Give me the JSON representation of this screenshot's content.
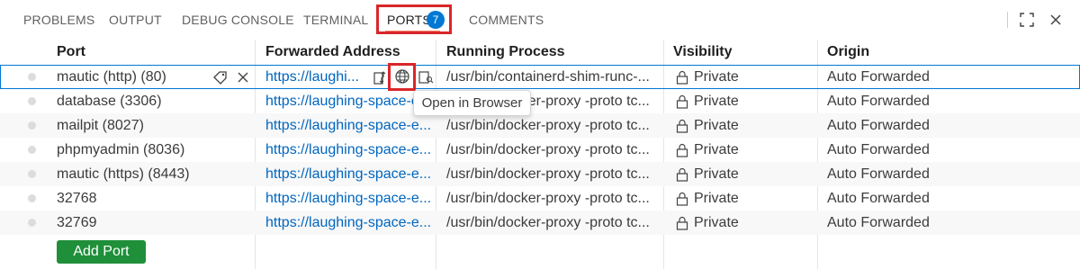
{
  "panel": {
    "tabs": [
      {
        "label": "PROBLEMS"
      },
      {
        "label": "OUTPUT"
      },
      {
        "label": "DEBUG CONSOLE"
      },
      {
        "label": "TERMINAL"
      },
      {
        "label": "PORTS",
        "badge": "7",
        "active": true
      },
      {
        "label": "COMMENTS"
      }
    ],
    "actions": [
      {
        "icon": "maximize-icon"
      },
      {
        "icon": "close-icon"
      }
    ]
  },
  "table": {
    "headers": [
      "Port",
      "Forwarded Address",
      "Running Process",
      "Visibility",
      "Origin"
    ],
    "rows": [
      {
        "port": "mautic (http) (80)",
        "address": "https://laughi...",
        "process": "/usr/bin/containerd-shim-runc-...",
        "visibility": "Private",
        "origin": "Auto Forwarded"
      },
      {
        "port": "database (3306)",
        "address": "https://laughing-space-e...",
        "process": "/usr/bin/docker-proxy -proto tc...",
        "visibility": "Private",
        "origin": "Auto Forwarded"
      },
      {
        "port": "mailpit (8027)",
        "address": "https://laughing-space-e...",
        "process": "/usr/bin/docker-proxy -proto tc...",
        "visibility": "Private",
        "origin": "Auto Forwarded"
      },
      {
        "port": "phpmyadmin (8036)",
        "address": "https://laughing-space-e...",
        "process": "/usr/bin/docker-proxy -proto tc...",
        "visibility": "Private",
        "origin": "Auto Forwarded"
      },
      {
        "port": "mautic (https) (8443)",
        "address": "https://laughing-space-e...",
        "process": "/usr/bin/docker-proxy -proto tc...",
        "visibility": "Private",
        "origin": "Auto Forwarded"
      },
      {
        "port": "32768",
        "address": "https://laughing-space-e...",
        "process": "/usr/bin/docker-proxy -proto tc...",
        "visibility": "Private",
        "origin": "Auto Forwarded"
      },
      {
        "port": "32769",
        "address": "https://laughing-space-e...",
        "process": "/usr/bin/docker-proxy -proto tc...",
        "visibility": "Private",
        "origin": "Auto Forwarded"
      }
    ],
    "add_port_label": "Add Port"
  },
  "tooltip": {
    "text": "Open in Browser"
  },
  "colors": {
    "accent": "#0078d4",
    "link": "#0066bf",
    "highlight": "#d9262b",
    "add_button": "#1f8f3a"
  }
}
